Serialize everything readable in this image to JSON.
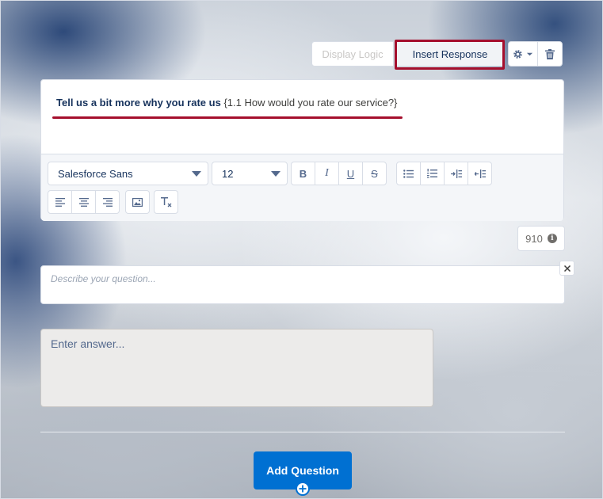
{
  "toolbar": {
    "display_logic_label": "Display Logic",
    "insert_response_label": "Insert Response"
  },
  "question": {
    "title_bold": "Tell us a bit more why you rate us",
    "title_reference": "{1.1 How would you rate our service?}"
  },
  "editor": {
    "font_value": "Salesforce Sans",
    "size_value": "12"
  },
  "char_count": "910",
  "description": {
    "placeholder": "Describe your question..."
  },
  "answer": {
    "placeholder": "Enter answer..."
  },
  "add_question_label": "Add Question",
  "colors": {
    "accent": "#0070d2",
    "highlight": "#a50f2d",
    "text": "#16325c"
  }
}
